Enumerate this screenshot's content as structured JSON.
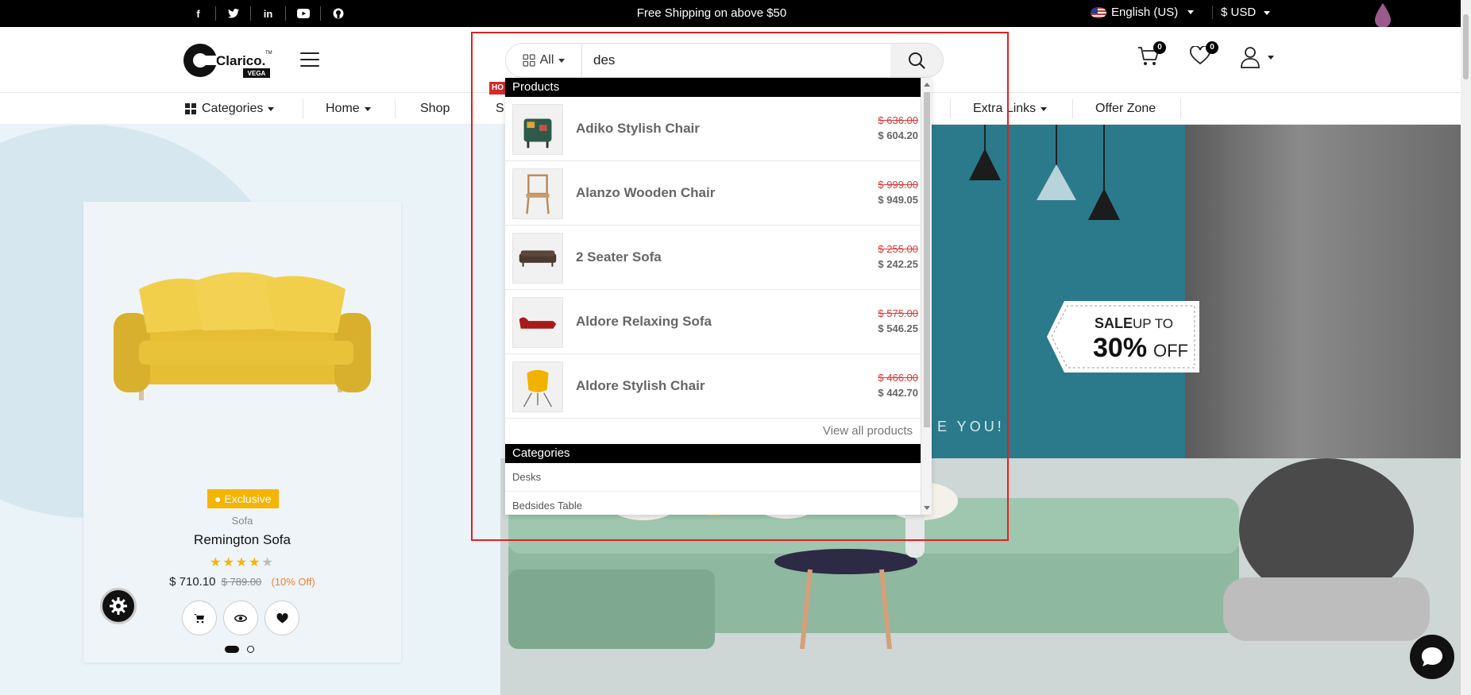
{
  "topbar": {
    "social": [
      {
        "name": "facebook",
        "glyph": "f"
      },
      {
        "name": "twitter",
        "glyph": "t"
      },
      {
        "name": "linkedin",
        "glyph": "in"
      },
      {
        "name": "youtube",
        "glyph": "▶"
      },
      {
        "name": "github",
        "glyph": "◎"
      }
    ],
    "shipping_text": "Free Shipping on above $50",
    "language": "English (US)",
    "currency": "$ USD"
  },
  "header": {
    "logo_text": "Clarico.",
    "logo_badge": "VEGA",
    "logo_tm": "TM",
    "search": {
      "category": "All",
      "query": "des"
    },
    "cart_count": "0",
    "wishlist_count": "0"
  },
  "nav": {
    "categories": "Categories",
    "home": "Home",
    "shop": "Shop",
    "partial": "S",
    "hot_badge": "HO",
    "extra_links": "Extra Links",
    "offer_zone": "Offer Zone"
  },
  "hero": {
    "you_text": "E YOU!",
    "sale_line1": "SALE",
    "sale_upto": "UP TO",
    "sale_pct": "30%",
    "sale_off": "OFF"
  },
  "card": {
    "badge": "Exclusive",
    "type": "Sofa",
    "name": "Remington Sofa",
    "rating": 4,
    "rating_max": 5,
    "price": "$ 710.10",
    "old_price": "$ 789.00",
    "discount": "(10% Off)"
  },
  "dropdown": {
    "products_heading": "Products",
    "products": [
      {
        "name": "Adiko Stylish Chair",
        "old": "$ 636.00",
        "new": "$ 604.20"
      },
      {
        "name": "Alanzo Wooden Chair",
        "old": "$ 999.00",
        "new": "$ 949.05"
      },
      {
        "name": "2 Seater Sofa",
        "old": "$ 255.00",
        "new": "$ 242.25"
      },
      {
        "name": "Aldore Relaxing Sofa",
        "old": "$ 575.00",
        "new": "$ 546.25"
      },
      {
        "name": "Aldore Stylish Chair",
        "old": "$ 466.00",
        "new": "$ 442.70"
      }
    ],
    "view_all": "View all products",
    "categories_heading": "Categories",
    "categories": [
      "Desks",
      "Bedsides Table"
    ]
  },
  "colors": {
    "accent": "#000000",
    "badge_yellow": "#f5b400",
    "strike_red": "#d83b3b",
    "highlight": "#e02020"
  }
}
